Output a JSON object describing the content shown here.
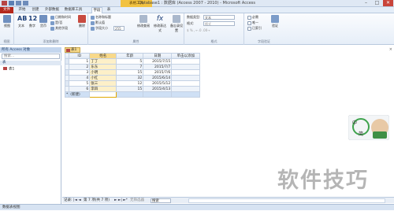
{
  "window": {
    "title": "Database1 : 数据库 (Access 2007 - 2010) - Microsoft Access",
    "context_tab": "表格工具",
    "minimize": "–",
    "maximize": "□",
    "close": "✕"
  },
  "tabs": [
    {
      "label": "文件"
    },
    {
      "label": "开始"
    },
    {
      "label": "创建"
    },
    {
      "label": "外部数据"
    },
    {
      "label": "数据库工具"
    },
    {
      "label": "字段"
    },
    {
      "label": "表"
    }
  ],
  "ribbon": {
    "groups": [
      {
        "label": "视图"
      },
      {
        "label": "添加和删除"
      },
      {
        "label": "属性"
      },
      {
        "label": "格式"
      },
      {
        "label": "字段验证"
      }
    ],
    "view_label": "视图",
    "text_label": "文本",
    "number_label": "12",
    "number_sub": "数字",
    "currency_label": "货币",
    "more_fields": "其他字段",
    "date_time": "日期和时间",
    "yes_no": "是/否",
    "more_fields2": "其他字段",
    "delete_label": "删除",
    "name_caption": "名称和标题",
    "default_value": "默认值",
    "field_size": "字段大小",
    "field_size_value": "255",
    "modify_lookups": "修改查阅",
    "modify_expression": "修改表达式",
    "memo_settings": "备忘录设置",
    "data_type_label": "数据类型:",
    "data_type_value": "文本",
    "format_label": "格式:",
    "format_value": "格式",
    "required": "必需",
    "unique": "唯一",
    "indexed": "已索引",
    "validation": "验证"
  },
  "nav_pane": {
    "header": "所有 Access 对象",
    "search_placeholder": "搜索...",
    "group": "表",
    "items": [
      {
        "label": "表1"
      }
    ]
  },
  "document": {
    "tab_label": "表1",
    "columns": [
      "ID",
      "姓名",
      "年龄",
      "日期",
      "单击以添加"
    ],
    "rows": [
      {
        "id": "1",
        "name": "丁丁",
        "age": "5",
        "date": "2015/7/15"
      },
      {
        "id": "2",
        "name": "东东",
        "age": "7",
        "date": "2015/7/7"
      },
      {
        "id": "3",
        "name": "小明",
        "age": "15",
        "date": "2015/7/6"
      },
      {
        "id": "4",
        "name": "小红",
        "age": "32",
        "date": "2015/6/14"
      },
      {
        "id": "5",
        "name": "张三",
        "age": "12",
        "date": "2015/5/12"
      },
      {
        "id": "6",
        "name": "李四",
        "age": "15",
        "date": "2015/4/13"
      }
    ],
    "new_row": "(新建)",
    "new_marker": "*"
  },
  "record_nav": {
    "label": "记录:",
    "position": "第 7 项(共 7 项)",
    "filter": "无筛选器",
    "search": "搜索"
  },
  "status": {
    "text": "数据表视图"
  },
  "ime": {
    "char_top": "中",
    "char_bottom": "简"
  },
  "watermark": "软件技巧",
  "colors": {
    "file_tab": "#b5281c",
    "context_tab": "#f2c240",
    "accent_blue": "#20406a"
  }
}
